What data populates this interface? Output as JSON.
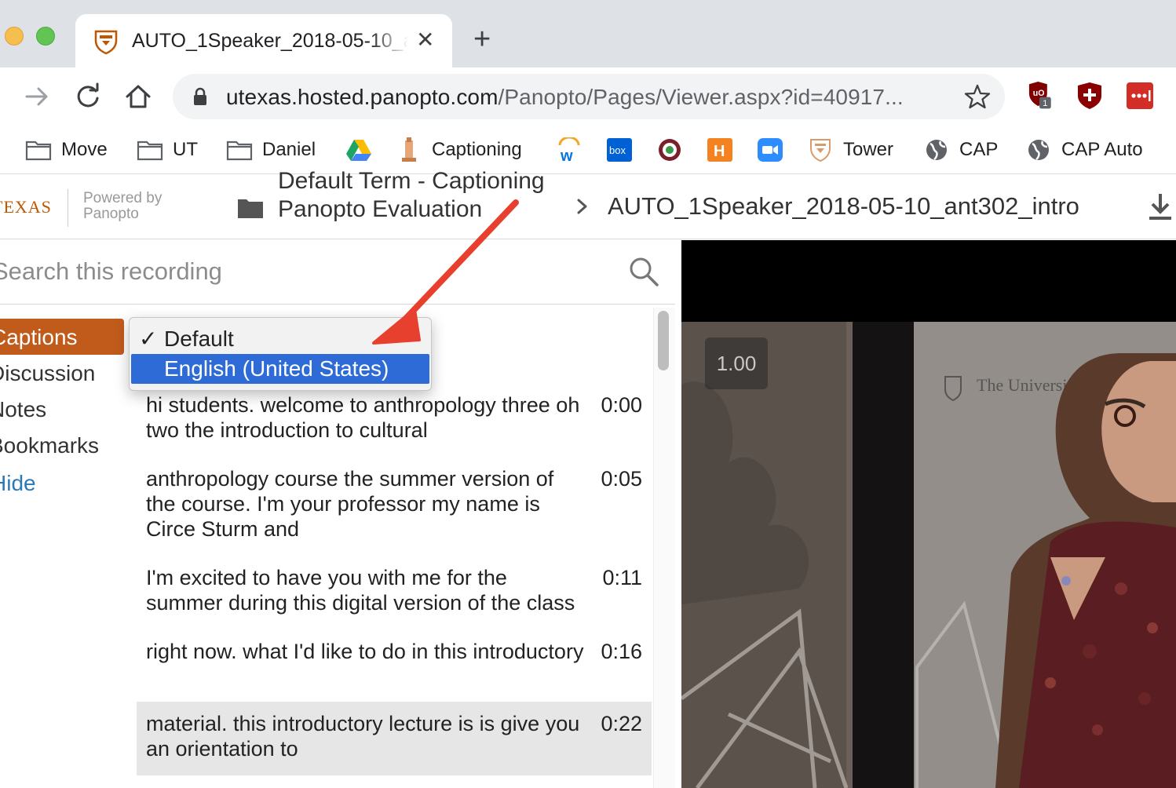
{
  "browser": {
    "tab_title": "AUTO_1Speaker_2018-05-10_ant302_intro",
    "url_host": "utexas.hosted.panopto.com",
    "url_path": "/Panopto/Pages/Viewer.aspx?id=40917...",
    "extension_badge": "1",
    "bookmarks": [
      {
        "label": "Move",
        "icon": "folder-icon"
      },
      {
        "label": "UT",
        "icon": "folder-icon"
      },
      {
        "label": "Daniel",
        "icon": "folder-icon"
      },
      {
        "label": "",
        "icon": "google-drive-icon"
      },
      {
        "label": "Captioning",
        "icon": "ut-tower-icon"
      },
      {
        "label": "",
        "icon": "workday-icon"
      },
      {
        "label": "box",
        "icon": "box-icon"
      },
      {
        "label": "",
        "icon": "seal-icon"
      },
      {
        "label": "H",
        "icon": "h-icon"
      },
      {
        "label": "",
        "icon": "zoom-icon"
      },
      {
        "label": "Tower",
        "icon": "ut-shield-icon"
      },
      {
        "label": "CAP",
        "icon": "globe-icon"
      },
      {
        "label": "CAP Auto",
        "icon": "globe-icon"
      }
    ]
  },
  "header": {
    "logo_text": "TEXAS",
    "powered_by": "Powered by",
    "powered_brand": "Panopto",
    "folder_name": "Default Term - Captioning Panopto Evaluation",
    "session_title": "AUTO_1Speaker_2018-05-10_ant302_intro"
  },
  "search": {
    "placeholder": "Search this recording"
  },
  "nav": {
    "captions": "Captions",
    "discussion": "Discussion",
    "notes": "Notes",
    "bookmarks": "Bookmarks",
    "hide": "Hide"
  },
  "language_menu": {
    "check": "✓",
    "options": [
      "Default",
      "English (United States)"
    ],
    "selected": "Default",
    "highlighted": "English (United States)"
  },
  "captions": [
    {
      "text": "hi students. welcome to anthropology three oh two the introduction to cultural",
      "time": "0:00"
    },
    {
      "text": "anthropology course the summer version of the course. I'm your professor my name is Circe Sturm and",
      "time": "0:05"
    },
    {
      "text": "I'm excited to have you with me for the summer during this digital version of the class",
      "time": "0:11"
    },
    {
      "text": "right now. what I'd like to do in this introductory",
      "time": "0:16"
    },
    {
      "text": "material. this introductory lecture is is give you an orientation to",
      "time": "0:22"
    }
  ],
  "video": {
    "speed": "1.00",
    "sign_text": "The University of"
  },
  "colors": {
    "accent_orange": "#c15b1c",
    "menu_highlight": "#2e6bd6",
    "arrow_red": "#e8402f",
    "link_blue": "#2a7ab8"
  }
}
